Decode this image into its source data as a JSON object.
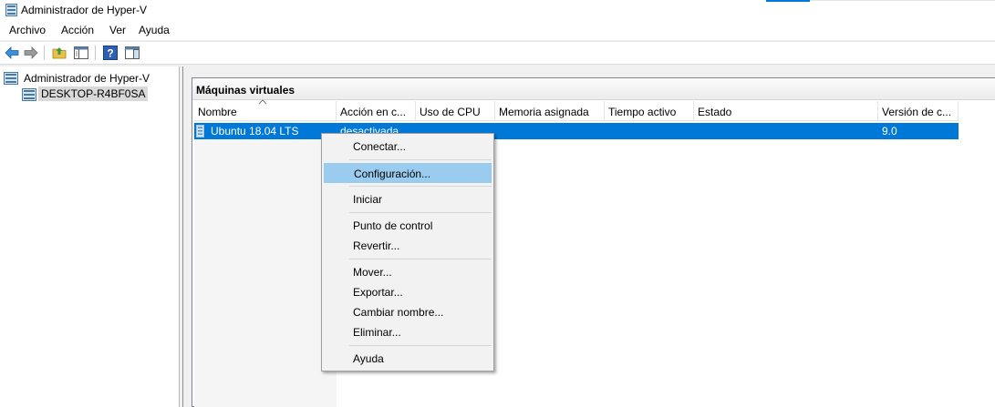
{
  "window": {
    "title": "Administrador de Hyper-V"
  },
  "menubar": {
    "items": [
      "Archivo",
      "Acción",
      "Ver",
      "Ayuda"
    ]
  },
  "toolbar": {
    "buttons": [
      "back-arrow-icon",
      "forward-arrow-icon",
      "up-folder-icon",
      "show-hide-tree-icon",
      "help-icon",
      "show-hide-action-pane-icon"
    ]
  },
  "tree": {
    "root": "Administrador de Hyper-V",
    "server": "DESKTOP-R4BF0SA"
  },
  "panel": {
    "title": "Máquinas virtuales",
    "columns": [
      "Nombre",
      "Acción en c...",
      "Uso de CPU",
      "Memoria asignada",
      "Tiempo activo",
      "Estado",
      "Versión de c..."
    ],
    "rows": [
      {
        "name": "Ubuntu 18.04 LTS",
        "action": "desactivada",
        "cpu": "",
        "memory": "",
        "uptime": "",
        "status": "",
        "version": "9.0"
      }
    ]
  },
  "context_menu": {
    "items": [
      "Conectar...",
      "Configuración...",
      "Iniciar",
      "Punto de control",
      "Revertir...",
      "Mover...",
      "Exportar...",
      "Cambiar nombre...",
      "Eliminar...",
      "Ayuda"
    ],
    "highlighted": "Configuración..."
  },
  "colors": {
    "selection": "#0078d7",
    "menu_highlight": "#99ccee"
  }
}
